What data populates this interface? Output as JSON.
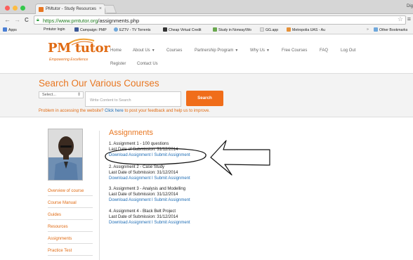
{
  "browser": {
    "tab_title": "PMtutor - Study Resources",
    "tab_close": "×",
    "right_label": "Dig",
    "nav_back": "←",
    "nav_forward": "→",
    "nav_reload": "C",
    "url_scheme": "https://",
    "url_host": "www.pmtutor.org",
    "url_path": "/assignments.php",
    "bookmarks": [
      {
        "label": "Apps",
        "color": "#4a7fd4"
      },
      {
        "label": "Pmtutor login",
        "color": "#ffffff"
      },
      {
        "label": "Campaign: PMP",
        "color": "#3b5998"
      },
      {
        "label": "EZTV - TV Torrents",
        "color": "#6fa8dc"
      },
      {
        "label": "Cheap Virtual Credit",
        "color": "#333333"
      },
      {
        "label": "Study in Norway/Wo",
        "color": "#6aa84f"
      },
      {
        "label": "GG.app",
        "color": "#dddddd"
      },
      {
        "label": "Metropolia UAS - Au",
        "color": "#e69138"
      },
      {
        "label": "»",
        "color": "#f2f2f2"
      },
      {
        "label": "Other Bookmarks",
        "color": "#6fa8dc"
      }
    ]
  },
  "site": {
    "logo_text": "PM tutor",
    "logo_tagline": "Empowering Excellence",
    "nav": {
      "home": "Home",
      "about": "About Us",
      "courses": "Courses",
      "partnership": "Partnership Program",
      "why_us": "Why Us",
      "free_courses": "Free Courses",
      "faq": "FAQ",
      "logout": "Log Out",
      "register": "Register",
      "contact": "Contact Us"
    },
    "brand_color": "#e87722",
    "link_color": "#1f6db5"
  },
  "search": {
    "title": "Search Our Various Courses",
    "select_value": "Select...",
    "input_placeholder": "Write Content to Search",
    "button_label": "Search",
    "problem_text": "Problem in accessing the website? ",
    "problem_link": "Click here",
    "problem_suffix": " to post your feedback and help us to improve."
  },
  "sidebar": {
    "items": [
      "Overview of course",
      "Course Manual",
      "Guides",
      "Resources",
      "Assignments",
      "Practice Test"
    ]
  },
  "assignments": {
    "title": "Assignments",
    "items": [
      {
        "name": "1. Assignment 1 - 100 questions",
        "date": "Last Date of Submission: 31/12/2014",
        "links": "Download Assignment I Submit Assignment"
      },
      {
        "name": "2. Assignment 2 - Case Study",
        "date": "Last Date of Submission: 31/12/2014",
        "links": "Download Assignment I Submit Assignment"
      },
      {
        "name": "3. Assignment 3 - Analysis and Modelling",
        "date": "Last Date of Submission: 31/12/2014",
        "links": "Download Assignment I Submit Assignment"
      },
      {
        "name": "4. Assignment 4 - Black Belt Project",
        "date": "Last Date of Submission: 31/12/2014",
        "links": "Download Assignment I Submit Assignment"
      }
    ]
  }
}
